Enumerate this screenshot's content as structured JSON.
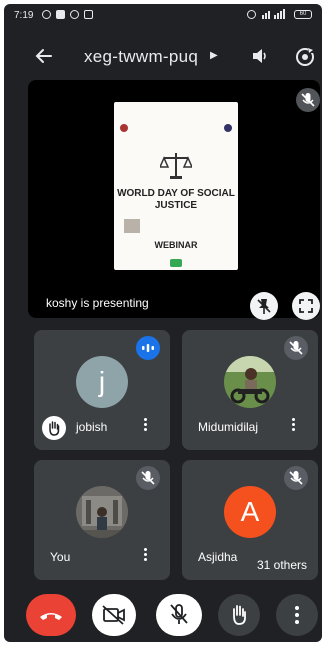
{
  "status_bar": {
    "time": "7:19",
    "battery": "60"
  },
  "meeting": {
    "code": "xeg-twwm-puq"
  },
  "presentation": {
    "label": "koshy is presenting",
    "slide": {
      "headline": "WORLD DAY OF SOCIAL JUSTICE",
      "subtitle": "WEBINAR"
    }
  },
  "participants": [
    {
      "name": "jobish",
      "avatar_letter": "j",
      "avatar_color": "#8ea4a8",
      "state": "speaking",
      "hand_raised": true
    },
    {
      "name": "Midumidilaj",
      "avatar": "photo",
      "state": "muted"
    },
    {
      "name": "You",
      "avatar": "photo",
      "state": "muted"
    },
    {
      "name": "Asjidha",
      "avatar_letter": "A",
      "avatar_color": "#f4511e",
      "state": "muted"
    }
  ],
  "others": {
    "label": "31 others"
  },
  "colors": {
    "end_call": "#ea4335",
    "speaking": "#1a73e8",
    "tile_bg": "#3c4043",
    "app_bg": "#202124"
  },
  "icons": [
    "back-arrow-icon",
    "speaker-icon",
    "camera-flip-icon",
    "mic-off-icon",
    "pin-off-icon",
    "fullscreen-icon",
    "more-vert-icon",
    "hand-icon",
    "phone-end-icon",
    "camera-off-icon"
  ]
}
